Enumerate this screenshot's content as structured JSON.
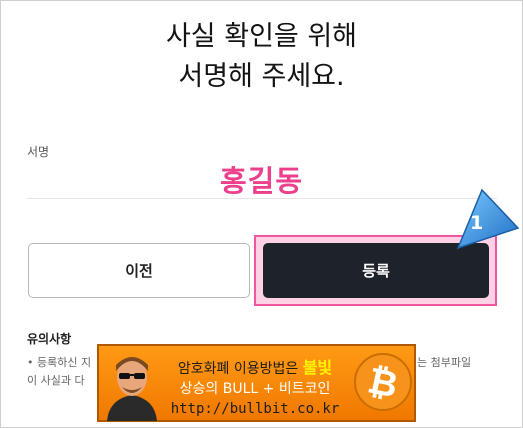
{
  "header": {
    "title_line1": "사실 확인을 위해",
    "title_line2": "서명해 주세요."
  },
  "signature": {
    "label": "서명",
    "value": "홍길동"
  },
  "buttons": {
    "prev_label": "이전",
    "register_label": "등록"
  },
  "step_marker": {
    "number": "1"
  },
  "notes": {
    "title": "유의사항",
    "line1": "• 등록하신 지",
    "line2": "이 사실과 다",
    "line1_end": "는 첨부파일"
  },
  "ad": {
    "text1": "암호화폐 이용방법은 ",
    "highlight": "불빛",
    "text2": "상승의 BULL + 비트코인",
    "url": "http://bullbit.co.kr"
  },
  "colors": {
    "signature": "#ec3f8c",
    "register_bg": "#1e232b",
    "highlight_border": "#f0559f",
    "ad_bg": "#f58a0a",
    "marker": "#3a8fd9"
  }
}
